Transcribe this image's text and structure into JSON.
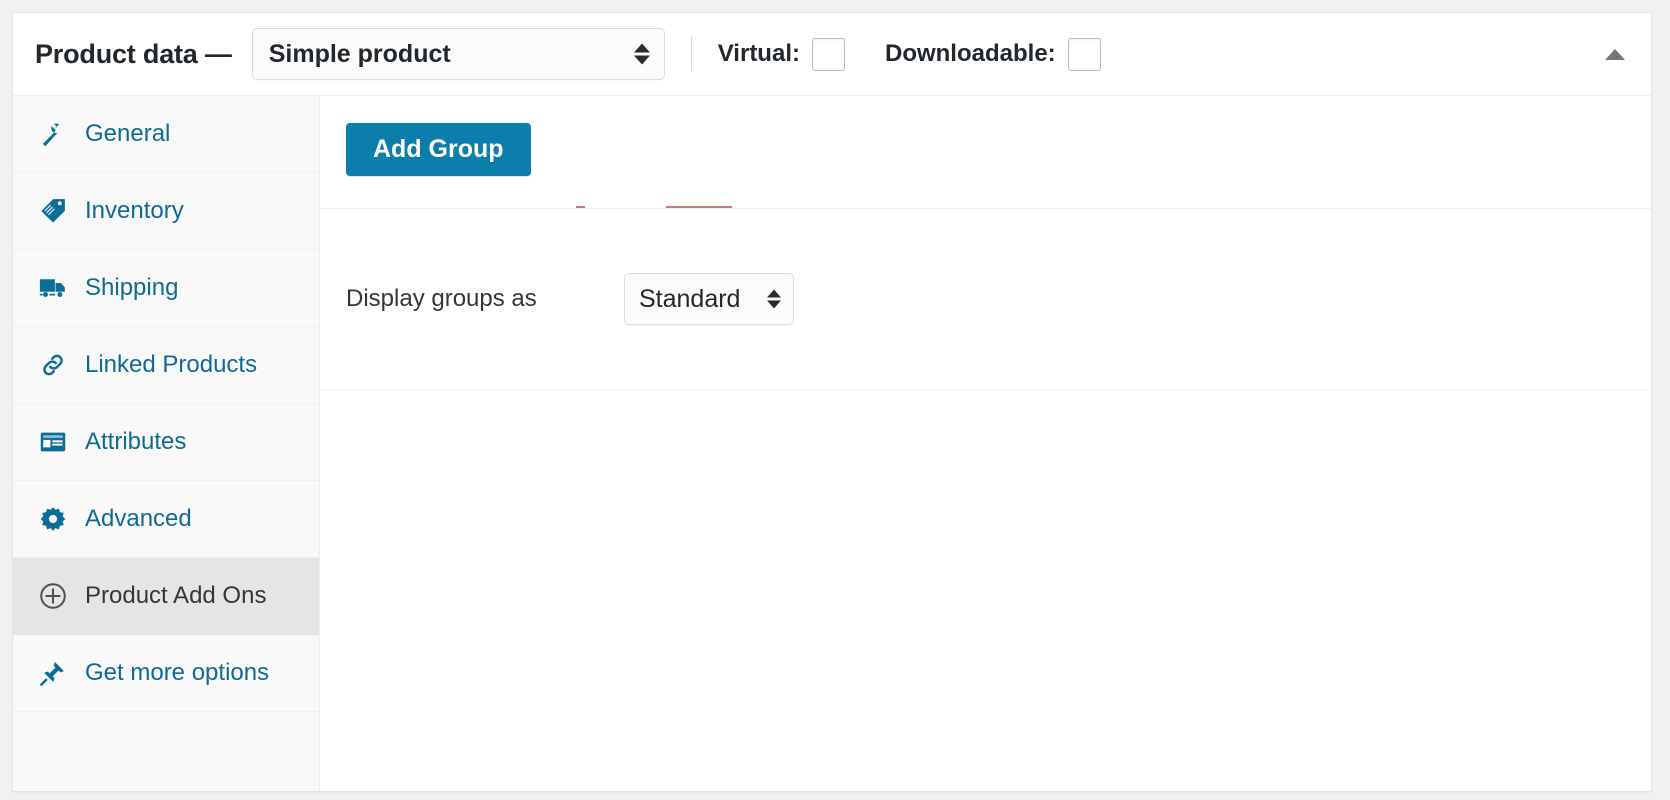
{
  "header": {
    "title": "Product data —",
    "product_type": {
      "name": "product-type-select",
      "value": "Simple product",
      "icon": "updown-spinner-icon"
    },
    "checkboxes": [
      {
        "label": "Virtual:",
        "name": "virtual-checkbox",
        "checked": false
      },
      {
        "label": "Downloadable:",
        "name": "downloadable-checkbox",
        "checked": false
      }
    ],
    "collapse_toggle": {
      "icon": "chevron-up-icon",
      "state": "expanded"
    }
  },
  "sidebar": {
    "items": [
      {
        "label": "General",
        "icon": "wrench-icon",
        "active": false
      },
      {
        "label": "Inventory",
        "icon": "tag-icon",
        "active": false
      },
      {
        "label": "Shipping",
        "icon": "truck-icon",
        "active": false
      },
      {
        "label": "Linked Products",
        "icon": "link-icon",
        "active": false
      },
      {
        "label": "Attributes",
        "icon": "id-card-icon",
        "active": false
      },
      {
        "label": "Advanced",
        "icon": "gear-icon",
        "active": false
      },
      {
        "label": "Product Add Ons",
        "icon": "plus-circle-icon",
        "active": true
      },
      {
        "label": "Get more options",
        "icon": "plug-icon",
        "active": false
      }
    ]
  },
  "content": {
    "add_group_button": "Add Group",
    "display_groups_label": "Display groups as",
    "display_groups_value": "Standard"
  },
  "colors": {
    "accent_blue": "#0b7eac",
    "link_blue": "#0f6a93",
    "active_tab_bg": "#e5e5e5",
    "sidebar_bg": "#f9f9f9",
    "page_bg": "#f1f1f1",
    "text_dark": "#23282d",
    "border": "#eeeeee"
  }
}
